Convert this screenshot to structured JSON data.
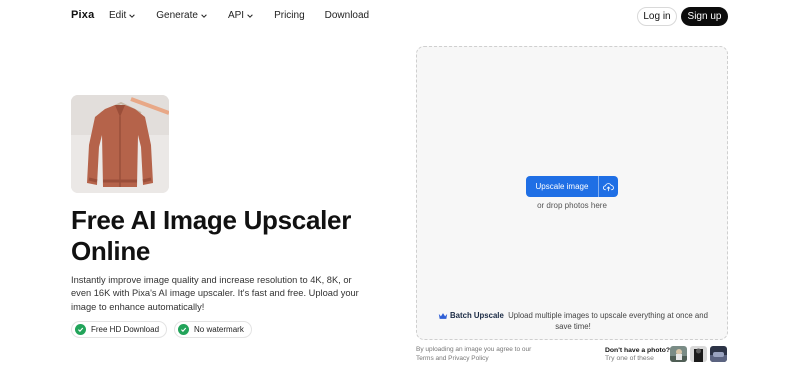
{
  "nav": {
    "logo": "Pixa",
    "links": [
      {
        "label": "Edit",
        "dropdown": true
      },
      {
        "label": "Generate",
        "dropdown": true
      },
      {
        "label": "API",
        "dropdown": true
      },
      {
        "label": "Pricing",
        "dropdown": false
      },
      {
        "label": "Download",
        "dropdown": false
      }
    ],
    "login": "Log in",
    "signup": "Sign up"
  },
  "hero": {
    "image_icon": "jacket-photo",
    "title": "Free AI Image Upscaler Online",
    "description": "Instantly improve image quality and increase resolution to 4K, 8K, or even 16K with Pixa's AI image upscaler. It's fast and free. Upload your image to enhance automatically!",
    "badges": [
      {
        "label": "Free HD Download",
        "icon": "check-circle-icon"
      },
      {
        "label": "No watermark",
        "icon": "check-circle-icon"
      }
    ]
  },
  "upload": {
    "button": "Upscale image",
    "cloud_icon": "cloud-upload-icon",
    "drop_text": "or drop photos here",
    "batch_title": "Batch Upscale",
    "batch_text": "Upload multiple images to upscale everything at once and save time!"
  },
  "footer": {
    "terms": "By uploading an image you agree to our Terms and Privacy Policy",
    "no_photo_question": "Don't have a photo?",
    "no_photo_try": "Try one of these"
  },
  "colors": {
    "accent": "#1f6fe5",
    "check": "#22a45a",
    "signup_bg": "#0c0c0c"
  }
}
